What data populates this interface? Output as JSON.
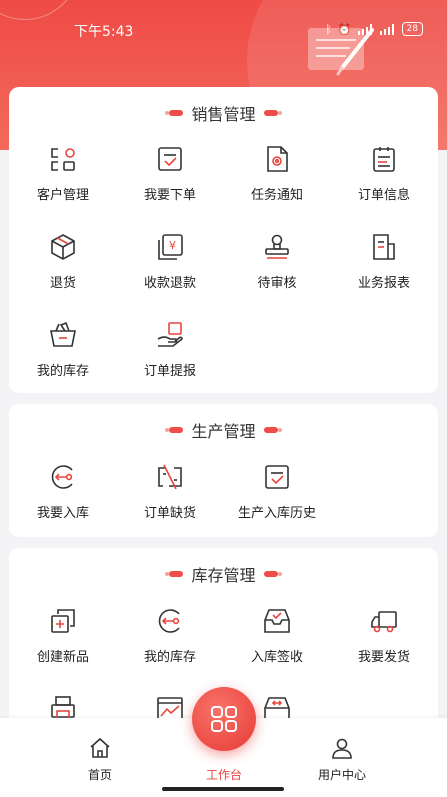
{
  "status_bar": {
    "time": "下午5:43",
    "battery": "28"
  },
  "colors": {
    "accent": "#e8453f",
    "header": "#ef4b46",
    "icon_stroke": "#333333"
  },
  "sections": [
    {
      "title": "销售管理",
      "items": [
        {
          "label": "客户管理",
          "icon": "customer-management-icon"
        },
        {
          "label": "我要下单",
          "icon": "place-order-icon"
        },
        {
          "label": "任务通知",
          "icon": "task-notice-icon"
        },
        {
          "label": "订单信息",
          "icon": "order-info-icon"
        },
        {
          "label": "退货",
          "icon": "return-goods-icon"
        },
        {
          "label": "收款退款",
          "icon": "payment-refund-icon"
        },
        {
          "label": "待审核",
          "icon": "pending-review-icon"
        },
        {
          "label": "业务报表",
          "icon": "business-report-icon"
        },
        {
          "label": "我的库存",
          "icon": "my-stock-basket-icon"
        },
        {
          "label": "订单提报",
          "icon": "order-submit-icon"
        }
      ]
    },
    {
      "title": "生产管理",
      "items": [
        {
          "label": "我要入库",
          "icon": "stock-in-icon"
        },
        {
          "label": "订单缺货",
          "icon": "out-of-stock-icon"
        },
        {
          "label": "生产入库历史",
          "icon": "production-history-icon"
        }
      ]
    },
    {
      "title": "库存管理",
      "items": [
        {
          "label": "创建新品",
          "icon": "create-product-icon"
        },
        {
          "label": "我的库存",
          "icon": "my-inventory-icon"
        },
        {
          "label": "入库签收",
          "icon": "inbound-receipt-icon"
        },
        {
          "label": "我要发货",
          "icon": "ship-goods-icon"
        }
      ]
    }
  ],
  "tabbar": {
    "items": [
      {
        "label": "首页",
        "icon": "home-icon"
      },
      {
        "label": "工作台",
        "icon": "workbench-icon",
        "active": true
      },
      {
        "label": "用户中心",
        "icon": "user-icon"
      }
    ]
  }
}
